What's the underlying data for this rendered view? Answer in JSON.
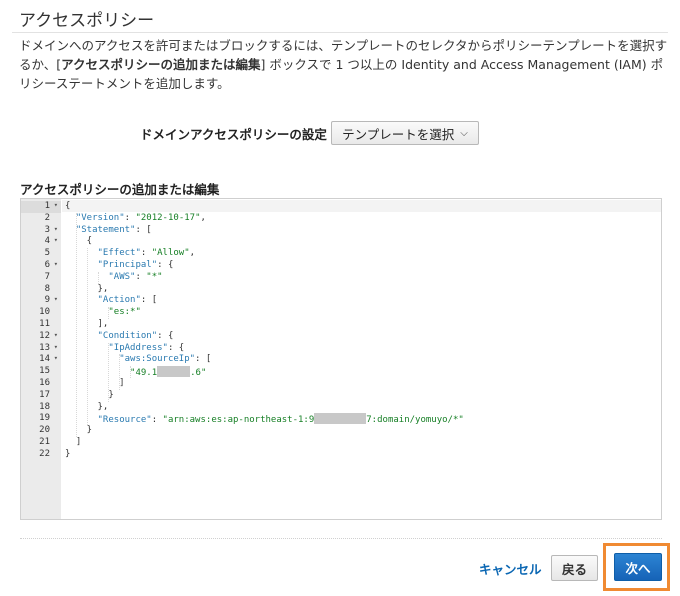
{
  "page": {
    "title": "アクセスポリシー",
    "description_part1": "ドメインへのアクセスを許可またはブロックするには、テンプレートのセレクタからポリシーテンプレートを選択するか、[",
    "description_bold": "アクセスポリシーの追加または編集",
    "description_part2": "] ボックスで 1 つ以上の Identity and Access Management (IAM) ポリシーステートメントを追加します。"
  },
  "domain_policy": {
    "label": "ドメインアクセスポリシーの設定",
    "template_button": "テンプレートを選択"
  },
  "editor": {
    "label": "アクセスポリシーの追加または編集",
    "line_numbers": [
      "1",
      "2",
      "3",
      "4",
      "5",
      "6",
      "7",
      "8",
      "9",
      "10",
      "11",
      "12",
      "13",
      "14",
      "15",
      "16",
      "17",
      "18",
      "19",
      "20",
      "21",
      "22"
    ],
    "folds": [
      "1",
      "3",
      "4",
      "6",
      "9",
      "12",
      "13",
      "14"
    ],
    "lines": [
      "{",
      "  \"Version\": \"2012-10-17\",",
      "  \"Statement\": [",
      "    {",
      "      \"Effect\": \"Allow\",",
      "      \"Principal\": {",
      "        \"AWS\": \"*\"",
      "      },",
      "      \"Action\": [",
      "        \"es:*\"",
      "      ],",
      "      \"Condition\": {",
      "        \"IpAddress\": {",
      "          \"aws:SourceIp\": [",
      "            \"49.1",
      "          ]",
      "        }",
      "      },",
      "      \"Resource\": \"arn:aws:es:ap-northeast-1:9",
      "    }",
      "  ]",
      "}"
    ],
    "line15_suffix": ".6\"",
    "line19_suffix": "7:domain/yomuyo/*\""
  },
  "footer": {
    "cancel": "キャンセル",
    "back": "戻る",
    "next": "次へ"
  },
  "colors": {
    "link": "#0b67b3",
    "primary": "#1663b7",
    "highlight": "#f08a32",
    "json_key": "#2a7ab0",
    "json_string": "#167f25"
  }
}
